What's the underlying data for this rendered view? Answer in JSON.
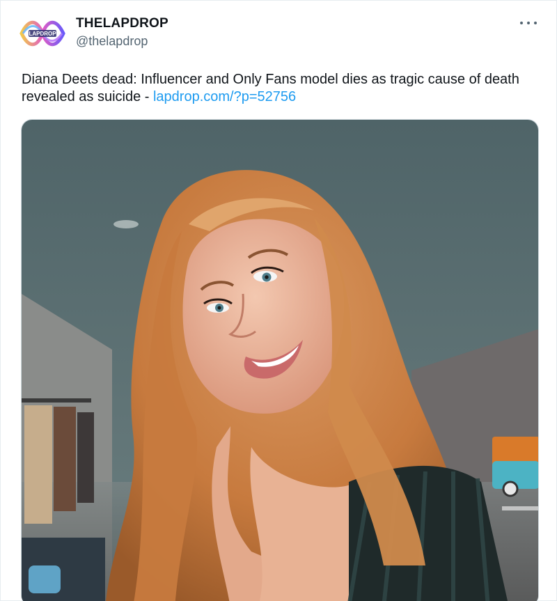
{
  "author": {
    "display_name": "THELAPDROP",
    "handle": "@thelapdrop",
    "avatar_text": "LAPDROP"
  },
  "tweet": {
    "text": "Diana Deets dead: Influencer and Only Fans model dies as tragic cause of death revealed as suicide - ",
    "link": "lapdrop.com/?p=52756"
  },
  "media": {
    "description_icon": "photo"
  },
  "colors": {
    "link": "#1d9bf0",
    "muted": "#536471",
    "text": "#0f1419"
  }
}
